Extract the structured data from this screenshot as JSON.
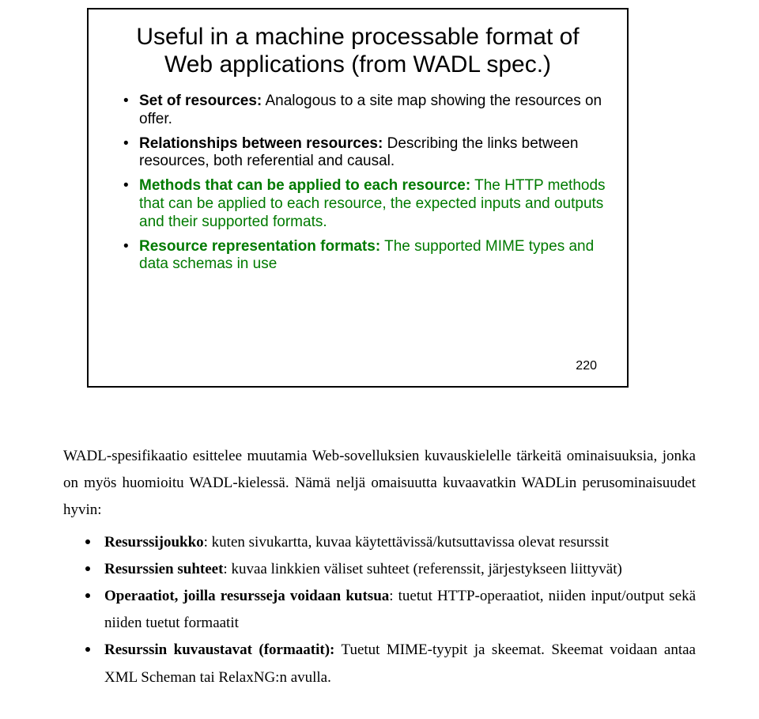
{
  "slide": {
    "title": "Useful in a machine processable format of Web applications (from WADL spec.)",
    "bullets": [
      {
        "label": "Set of resources:",
        "labelClass": "b",
        "rest": " Analogous to a site map showing the resources on offer."
      },
      {
        "label": "Relationships between resources:",
        "labelClass": "b",
        "rest": " Describing the links between resources, both referential and causal."
      },
      {
        "label": "Methods that can be applied to each resource:",
        "labelClass": "b green",
        "rest": " The HTTP methods that can be applied to each resource, the expected inputs and outputs and their supported formats.",
        "restClass": "green"
      },
      {
        "label": "Resource representation formats:",
        "labelClass": "b green",
        "rest": " The supported MIME types and data schemas in use",
        "restClass": "green"
      }
    ],
    "page": "220"
  },
  "body": {
    "para": "WADL-spesifikaatio esittelee muutamia Web-sovelluksien kuvauskielelle tärkeitä ominaisuuksia, jonka on myös huomioitu WADL-kielessä. Nämä neljä omaisuutta kuvaavatkin WADLin perusominaisuudet hyvin:",
    "bullets": [
      {
        "label": "Resurssijoukko",
        "rest": ": kuten sivukartta, kuvaa käytettävissä/kutsuttavissa olevat resurssit"
      },
      {
        "label": "Resurssien suhteet",
        "rest": ": kuvaa linkkien väliset suhteet (referenssit, järjestykseen liittyvät)"
      },
      {
        "label": "Operaatiot, joilla resursseja voidaan kutsua",
        "rest": ": tuetut HTTP-operaatiot, niiden input/output sekä niiden tuetut formaatit"
      },
      {
        "label": "Resurssin kuvaustavat (formaatit):",
        "rest": " Tuetut MIME-tyypit ja skeemat. Skeemat voidaan antaa XML Scheman tai RelaxNG:n avulla."
      }
    ]
  }
}
